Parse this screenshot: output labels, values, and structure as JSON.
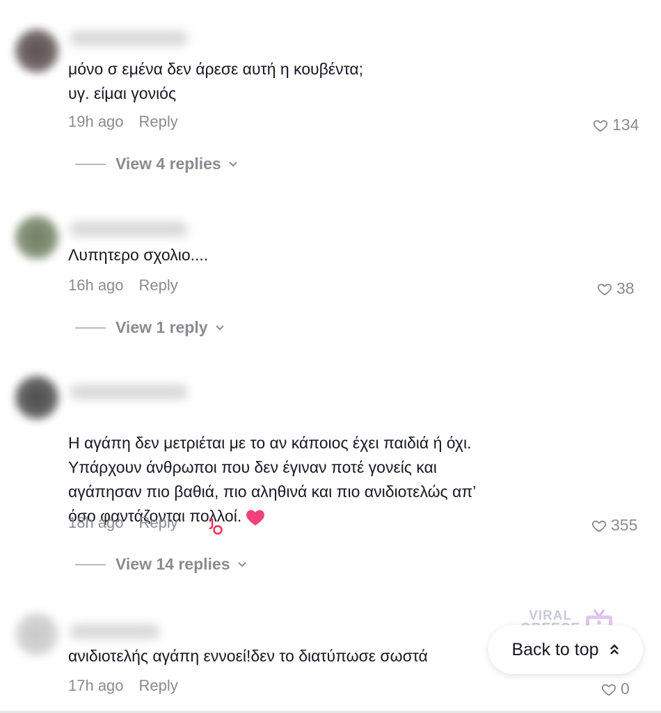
{
  "comments": [
    {
      "text": "μόνο σ εμένα δεν άρεσε αυτή η κουβέντα;\nυγ. είμαι γονιός",
      "time": "19h ago",
      "reply_label": "Reply",
      "likes": "134",
      "view_replies": "View 4 replies"
    },
    {
      "text": "Λυπητερο σχολιο....",
      "time": "16h ago",
      "reply_label": "Reply",
      "likes": "38",
      "view_replies": "View 1 reply"
    },
    {
      "text": "Η αγάπη δεν μετριέται με το αν κάποιος έχει παιδιά ή όχι.\nΥπάρχουν άνθρωποι που δεν έγιναν ποτέ γονείς και\nαγάπησαν πιο βαθιά, πιο αληθινά και πιο ανιδιοτελώς απ’\nόσο φαντάζονται πολλοί.",
      "time": "18h ago",
      "reply_label": "Reply",
      "likes": "355",
      "view_replies": "View 14 replies"
    },
    {
      "text": "ανιδιοτελής αγάπη εννοεί!δεν το διατύπωσε σωστά",
      "time": "17h ago",
      "reply_label": "Reply",
      "likes": "0"
    }
  ],
  "back_to_top": "Back to top",
  "watermark": {
    "line1": "VIRAL",
    "line2": "GREECE"
  },
  "colors": {
    "muted": "#8a8b91",
    "text": "#161823",
    "heart": "#fe2c55"
  }
}
